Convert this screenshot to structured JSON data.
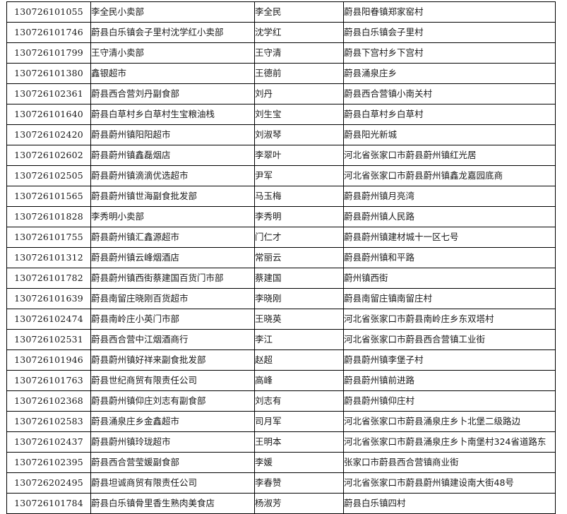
{
  "table": {
    "columns": [
      {
        "key": "code",
        "header": ""
      },
      {
        "key": "name",
        "header": ""
      },
      {
        "key": "owner",
        "header": ""
      },
      {
        "key": "address",
        "header": ""
      }
    ],
    "rows": [
      {
        "code": "130726101055",
        "name": "李全民小卖部",
        "owner": "李全民",
        "address": "蔚县阳眷镇郑家窑村"
      },
      {
        "code": "130726101746",
        "name": "蔚县白乐镇会子里村沈学红小卖部",
        "owner": "沈学红",
        "address": "蔚县白乐镇会子里村"
      },
      {
        "code": "130726101799",
        "name": "王守清小卖部",
        "owner": "王守清",
        "address": "蔚县下宫村乡下宫村"
      },
      {
        "code": "130726101380",
        "name": "鑫银超市",
        "owner": "王德前",
        "address": "蔚县涌泉庄乡"
      },
      {
        "code": "130726102361",
        "name": "蔚县西合营刘丹副食部",
        "owner": "刘丹",
        "address": "蔚县西合营镇小南关村"
      },
      {
        "code": "130726101640",
        "name": "蔚县白草村乡白草村生宝粮油栈",
        "owner": "刘生宝",
        "address": "蔚县白草村乡白草村"
      },
      {
        "code": "130726102420",
        "name": "蔚县蔚州镇阳阳超市",
        "owner": "刘淑琴",
        "address": "蔚县阳光新城"
      },
      {
        "code": "130726102602",
        "name": "蔚县蔚州镇鑫磊烟店",
        "owner": "李翠叶",
        "address": "河北省张家口市蔚县蔚州镇红光居"
      },
      {
        "code": "130726102505",
        "name": "蔚县蔚州镇滴滴优选超市",
        "owner": "尹军",
        "address": "河北省张家口市蔚县蔚州镇鑫龙嘉园底商"
      },
      {
        "code": "130726101565",
        "name": "蔚县蔚州镇世海副食批发部",
        "owner": "马玉梅",
        "address": "蔚县蔚州镇月亮湾"
      },
      {
        "code": "130726101828",
        "name": "李秀明小卖部",
        "owner": "李秀明",
        "address": "蔚县蔚州镇人民路"
      },
      {
        "code": "130726101755",
        "name": "蔚县蔚州镇汇鑫源超市",
        "owner": "门仁才",
        "address": "蔚县蔚州镇建材城十一区七号"
      },
      {
        "code": "130726101312",
        "name": "蔚县蔚州镇云峰烟酒店",
        "owner": "常丽云",
        "address": "蔚县蔚州镇和平路"
      },
      {
        "code": "130726101782",
        "name": "蔚县蔚州镇西街蔡建国百货门市部",
        "owner": "蔡建国",
        "address": "蔚州镇西街"
      },
      {
        "code": "130726101639",
        "name": "蔚县南留庄晓刚百货超市",
        "owner": "李晓刚",
        "address": "蔚县南留庄镇南留庄村"
      },
      {
        "code": "130726102474",
        "name": "蔚县南岭庄小英门市部",
        "owner": "王晓英",
        "address": "河北省张家口市蔚县南岭庄乡东双塔村"
      },
      {
        "code": "130726102531",
        "name": "蔚县西合营中江烟酒商行",
        "owner": "李江",
        "address": "河北省张家口市蔚县西合营镇工业街"
      },
      {
        "code": "130726101946",
        "name": "蔚县蔚州镇好祥来副食批发部",
        "owner": "赵超",
        "address": "蔚县蔚州镇李堡子村"
      },
      {
        "code": "130726101763",
        "name": "蔚县世纪商贸有限责任公司",
        "owner": "高峰",
        "address": "蔚县蔚州镇前进路"
      },
      {
        "code": "130726102368",
        "name": "蔚县蔚州镇仰庄刘志有副食部",
        "owner": "刘志有",
        "address": "蔚县蔚州镇仰庄村"
      },
      {
        "code": "130726102583",
        "name": "蔚县涌泉庄乡金鑫超市",
        "owner": "司月军",
        "address": "河北省张家口市蔚县涌泉庄乡卜北堡二级路边"
      },
      {
        "code": "130726102437",
        "name": "蔚县蔚州镇玲珑超市",
        "owner": "王明本",
        "address": "河北省张家口市蔚县涌泉庄乡卜南堡村324省道路东"
      },
      {
        "code": "130726102395",
        "name": "蔚县西合营莹媛副食部",
        "owner": "李媛",
        "address": "张家口市蔚县西合营镇商业街"
      },
      {
        "code": "130726202495",
        "name": "蔚县坦诚商贸有限责任公司",
        "owner": "李春赞",
        "address": "河北省张家口市蔚县蔚州镇建设南大街48号"
      },
      {
        "code": "130726101784",
        "name": "蔚县白乐镇骨里香生熟肉美食店",
        "owner": "杨淑芳",
        "address": "蔚县白乐镇四村"
      }
    ]
  }
}
